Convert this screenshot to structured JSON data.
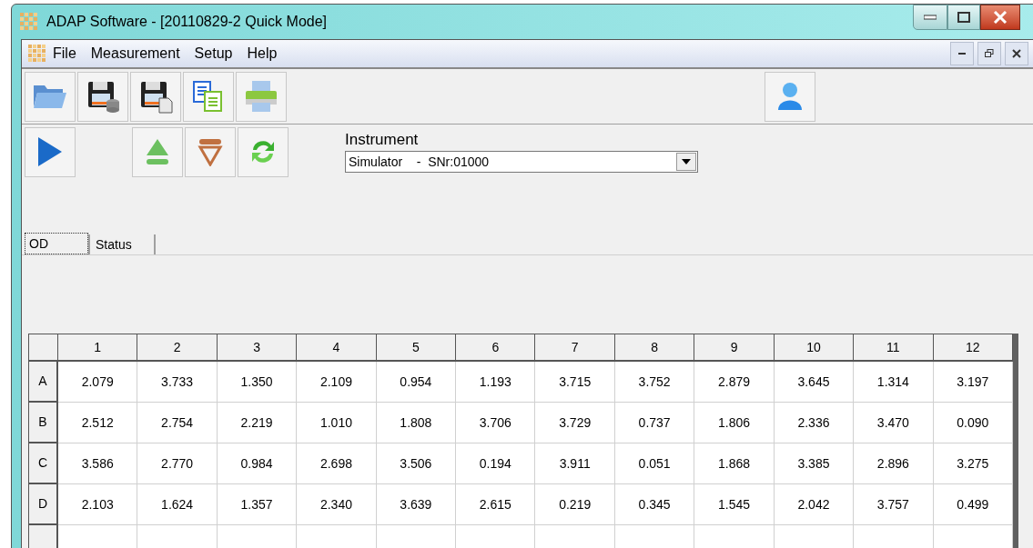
{
  "window": {
    "title": "ADAP Software - [20110829-2 Quick Mode]"
  },
  "menu": {
    "items": [
      "File",
      "Measurement",
      "Setup",
      "Help"
    ]
  },
  "instrument": {
    "label": "Instrument",
    "value": "Simulator    -  SNr:01000"
  },
  "tabs": [
    {
      "label": "OD",
      "selected": true
    },
    {
      "label": "Status",
      "selected": false
    }
  ],
  "table": {
    "columns": [
      "1",
      "2",
      "3",
      "4",
      "5",
      "6",
      "7",
      "8",
      "9",
      "10",
      "11",
      "12"
    ],
    "rows": [
      {
        "label": "A",
        "cells": [
          "2.079",
          "3.733",
          "1.350",
          "2.109",
          "0.954",
          "1.193",
          "3.715",
          "3.752",
          "2.879",
          "3.645",
          "1.314",
          "3.197"
        ]
      },
      {
        "label": "B",
        "cells": [
          "2.512",
          "2.754",
          "2.219",
          "1.010",
          "1.808",
          "3.706",
          "3.729",
          "0.737",
          "1.806",
          "2.336",
          "3.470",
          "0.090"
        ]
      },
      {
        "label": "C",
        "cells": [
          "3.586",
          "2.770",
          "0.984",
          "2.698",
          "3.506",
          "0.194",
          "3.911",
          "0.051",
          "1.868",
          "3.385",
          "2.896",
          "3.275"
        ]
      },
      {
        "label": "D",
        "cells": [
          "2.103",
          "1.624",
          "1.357",
          "2.340",
          "3.639",
          "2.615",
          "0.219",
          "0.345",
          "1.545",
          "2.042",
          "3.757",
          "0.499"
        ]
      }
    ]
  }
}
